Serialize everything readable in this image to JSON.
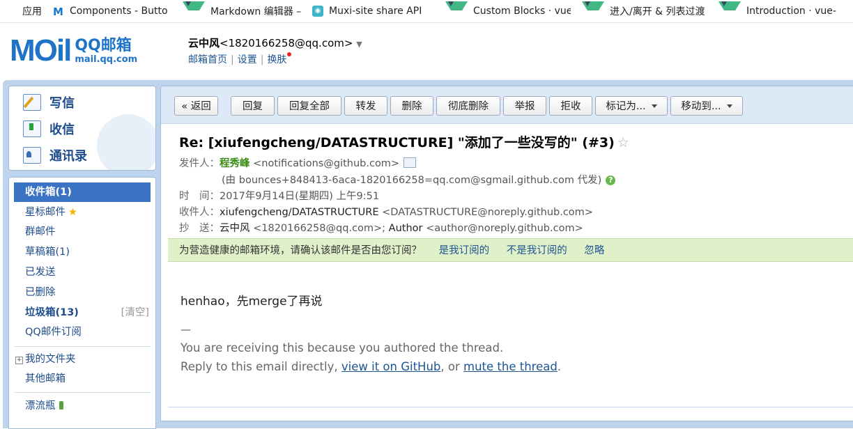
{
  "bookmarks": [
    {
      "label": "应用",
      "icon": "apps-grid-icon"
    },
    {
      "label": "Components - Butto",
      "icon": "material-ui-icon"
    },
    {
      "label": "Markdown 编辑器 –",
      "icon": "vue-icon"
    },
    {
      "label": "Muxi-site share API",
      "icon": "muxi-icon"
    },
    {
      "label": "Custom Blocks · vue",
      "icon": "vue-icon"
    },
    {
      "label": "进入/离开 & 列表过渡",
      "icon": "vue-icon"
    },
    {
      "label": "Introduction · vue-lo",
      "icon": "vue-icon"
    }
  ],
  "header": {
    "logo_main": "MOil",
    "logo_title": "QQ邮箱",
    "logo_url": "mail.qq.com",
    "user_name": "云中风",
    "user_email": "<1820166258@qq.com>",
    "links": [
      "邮箱首页",
      "设置",
      "换肤"
    ]
  },
  "compose": {
    "write": "写信",
    "receive": "收信",
    "contacts": "通讯录"
  },
  "folders": {
    "inbox": "收件箱(1)",
    "starred": "星标邮件",
    "group": "群邮件",
    "drafts": "草稿箱(1)",
    "sent": "已发送",
    "deleted": "已删除",
    "spam": "垃圾箱(13)",
    "spam_clear": "[清空]",
    "subscriptions": "QQ邮件订阅",
    "my_folders": "我的文件夹",
    "other_mail": "其他邮箱",
    "drift_bottle": "漂流瓶"
  },
  "toolbar": {
    "back": "« 返回",
    "reply": "回复",
    "reply_all": "回复全部",
    "forward": "转发",
    "delete": "删除",
    "delete_perm": "彻底删除",
    "report": "举报",
    "reject": "拒收",
    "mark_as": "标记为...",
    "move_to": "移动到..."
  },
  "email": {
    "subject": "Re: [xiufengcheng/DATASTRUCTURE] \"添加了一些没写的\" (#3)",
    "from_label": "发件人：",
    "from_name": "程秀峰",
    "from_email": "<notifications@github.com>",
    "via": "(由 bounces+848413-6aca-1820166258=qq.com@sgmail.github.com 代发)",
    "time_label": "时　间：",
    "time": "2017年9月14日(星期四) 上午9:51",
    "to_label": "收件人：",
    "to_name": "xiufengcheng/DATASTRUCTURE",
    "to_email": "<DATASTRUCTURE@noreply.github.com>",
    "cc_label": "抄　送：",
    "cc_name1": "云中风",
    "cc_email1": "<1820166258@qq.com>;",
    "cc_name2": "Author",
    "cc_email2": "<author@noreply.github.com>",
    "notice": "为营造健康的邮箱环境，请确认该邮件是否由您订阅？",
    "notice_yes": "是我订阅的",
    "notice_no": "不是我订阅的",
    "notice_ignore": "忽略",
    "body": "henhao，先merge了再说",
    "dash": "—",
    "footer1": "You are receiving this because you authored the thread.",
    "footer2_pre": "Reply to this email directly, ",
    "footer2_link1": "view it on GitHub",
    "footer2_mid": ", or ",
    "footer2_link2": "mute the thread",
    "footer2_end": "."
  },
  "colors": {
    "brand_blue": "#1f74c8",
    "active_folder": "#3a72c4",
    "sender_green": "#3b8c16",
    "notice_bg": "#e0f0c8"
  }
}
